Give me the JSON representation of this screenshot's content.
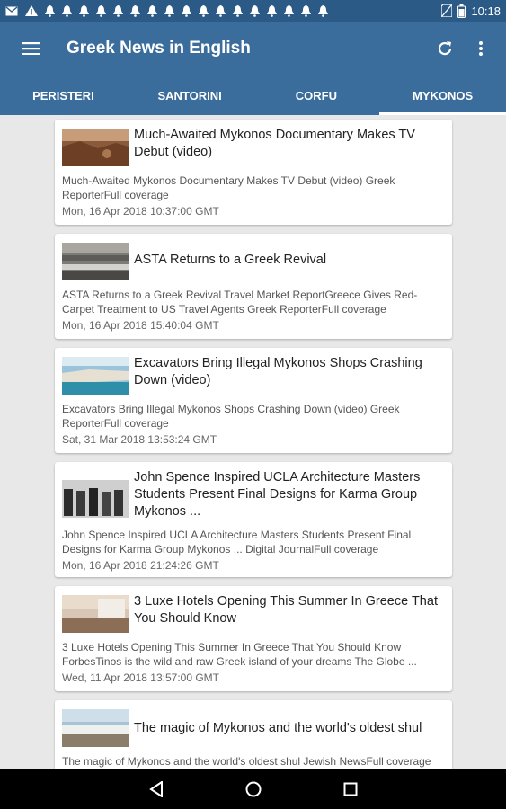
{
  "status": {
    "time": "10:18"
  },
  "app": {
    "title": "Greek News in English"
  },
  "tabs": [
    {
      "label": "PERISTERI"
    },
    {
      "label": "SANTORINI"
    },
    {
      "label": "CORFU"
    },
    {
      "label": "MYKONOS",
      "active": true
    }
  ],
  "articles": [
    {
      "headline": "Much-Awaited Mykonos Documentary Makes TV Debut (video)",
      "summary": "Much-Awaited Mykonos Documentary Makes TV Debut (video)  Greek ReporterFull coverage",
      "date": "Mon, 16 Apr 2018 10:37:00 GMT"
    },
    {
      "headline": "ASTA Returns to a Greek Revival",
      "summary": "ASTA Returns to a Greek Revival  Travel Market ReportGreece Gives Red-Carpet Treatment to US Travel Agents  Greek ReporterFull coverage",
      "date": "Mon, 16 Apr 2018 15:40:04 GMT"
    },
    {
      "headline": "Excavators Bring Illegal Mykonos Shops Crashing Down (video)",
      "summary": "Excavators Bring Illegal Mykonos Shops Crashing Down (video)  Greek ReporterFull coverage",
      "date": "Sat, 31 Mar 2018 13:53:24 GMT"
    },
    {
      "headline": "John Spence Inspired UCLA Architecture Masters Students Present Final Designs for Karma Group Mykonos ...",
      "summary": "John Spence Inspired UCLA Architecture Masters Students Present Final Designs for Karma Group Mykonos ...  Digital JournalFull coverage",
      "date": "Mon, 16 Apr 2018 21:24:26 GMT"
    },
    {
      "headline": "3 Luxe Hotels Opening This Summer In Greece That You Should Know",
      "summary": "3 Luxe Hotels Opening This Summer In Greece That You Should Know  ForbesTinos is the wild and raw Greek island of your dreams  The Globe ...",
      "date": "Wed, 11 Apr 2018 13:57:00 GMT"
    },
    {
      "headline": "The magic of Mykonos and the world's oldest shul",
      "summary": "The magic of Mykonos and the world's oldest shul  Jewish NewsFull coverage",
      "date": ""
    }
  ],
  "colors": {
    "app_bar": "#3a6d9c",
    "status_bar": "#2b5a86",
    "background": "#e8e8e8"
  },
  "icons": [
    "menu-icon",
    "refresh-icon",
    "more-vert-icon",
    "back-icon",
    "home-icon",
    "recents-icon"
  ]
}
